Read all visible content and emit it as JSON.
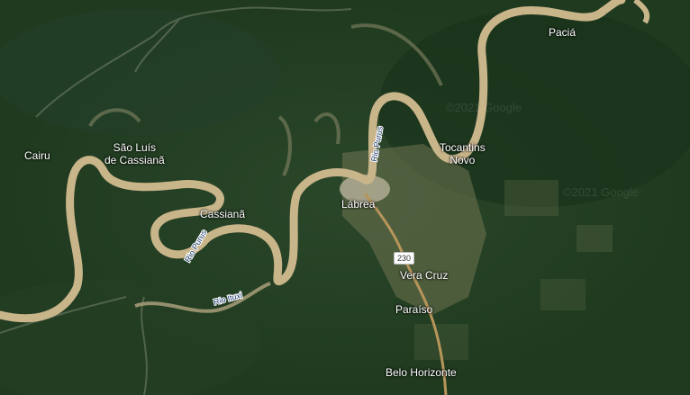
{
  "map": {
    "places": {
      "cairu": "Cairu",
      "sao_luis_line1": "São Luís",
      "sao_luis_line2": "de Cassianã",
      "cassiana": "Cassianã",
      "labrea": "Lábrea",
      "tocantins_line1": "Tocantins",
      "tocantins_line2": "Novo",
      "pacia": "Paciá",
      "vera_cruz": "Vera Cruz",
      "paraiso": "Paraíso",
      "belo_horizonte": "Belo Horizonte"
    },
    "rivers": {
      "purus_a": "Rio Purus",
      "purus_b": "Rio Purus",
      "ituxi": "Rio Ituxi"
    },
    "road_shield": "230",
    "watermark": "©2021 Google",
    "colors": {
      "forest": "#1f3a1f",
      "river": "#c9b58a",
      "road": "#b7955a",
      "cleared": "#7a7a55"
    }
  }
}
